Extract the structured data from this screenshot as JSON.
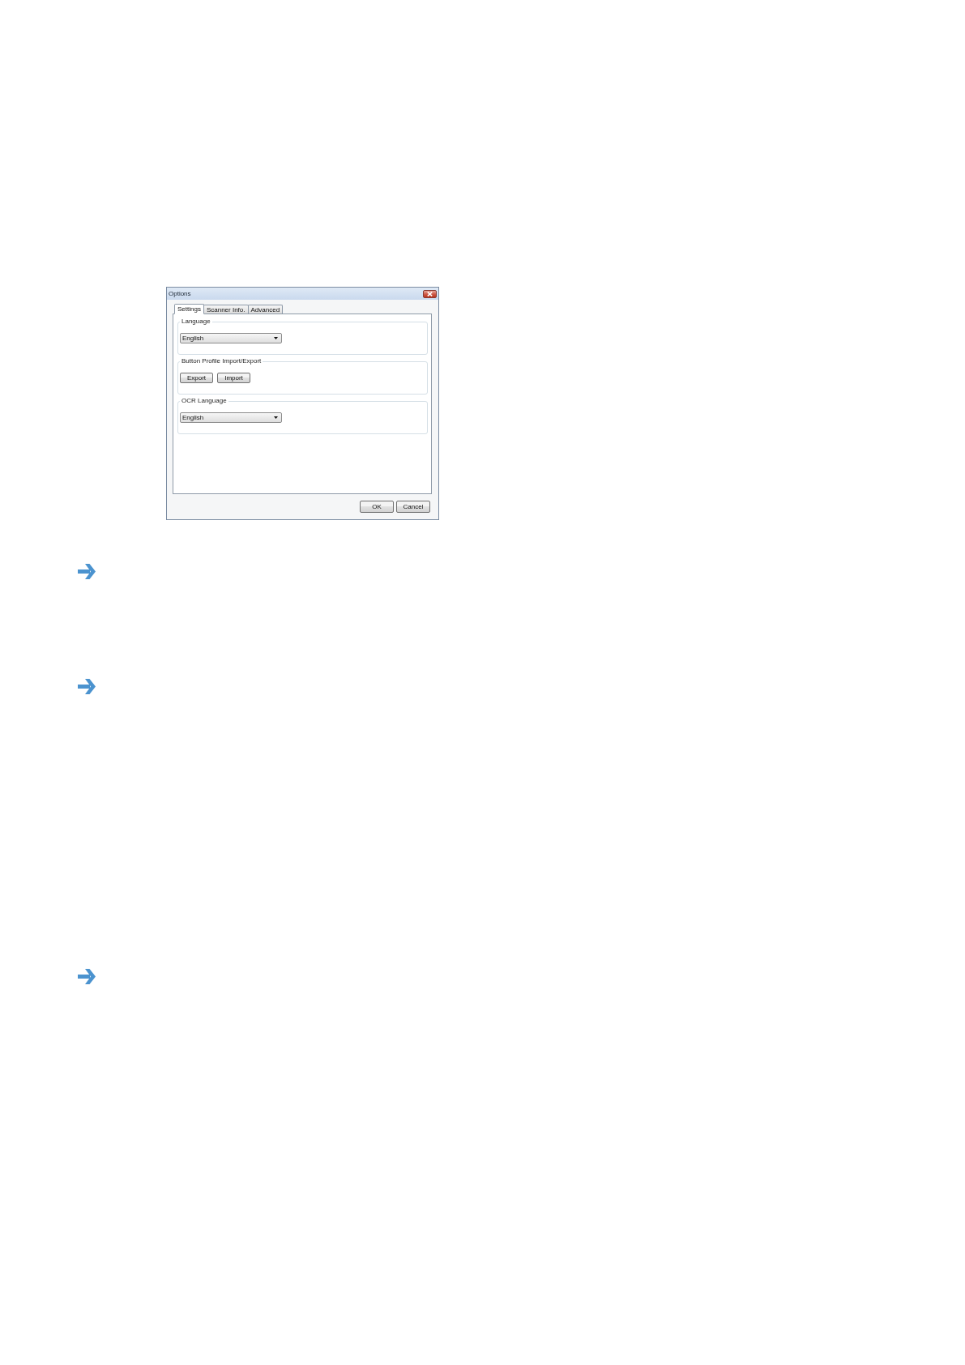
{
  "window": {
    "title": "Options"
  },
  "tabs": [
    {
      "label": "Settings",
      "selected": true
    },
    {
      "label": "Scanner Info.",
      "selected": false
    },
    {
      "label": "Advanced",
      "selected": false
    }
  ],
  "groups": [
    {
      "kind": "dropdown",
      "title": "Language",
      "value": "English"
    },
    {
      "kind": "buttons",
      "title": "Button Profile Import/Export",
      "buttons": [
        "Export",
        "Import"
      ]
    },
    {
      "kind": "dropdown",
      "title": "OCR Language",
      "value": "English"
    }
  ],
  "buttons": [
    "OK",
    "Cancel"
  ]
}
